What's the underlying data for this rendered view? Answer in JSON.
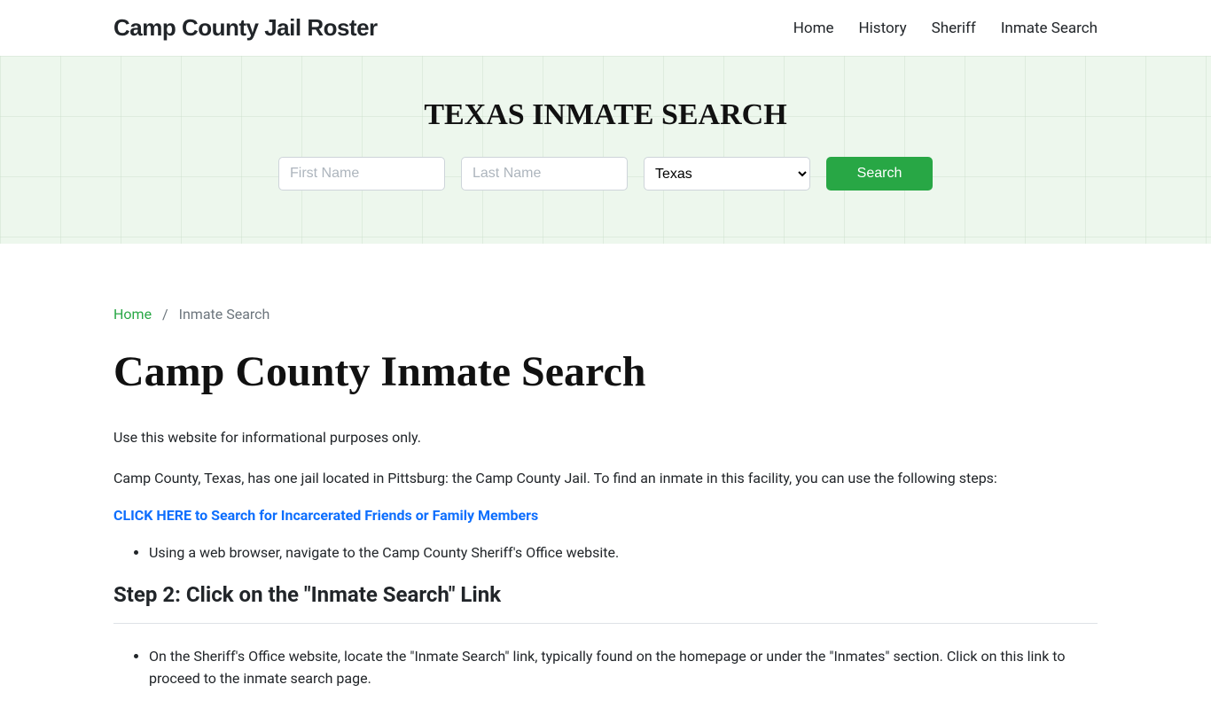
{
  "header": {
    "site_title": "Camp County Jail Roster",
    "nav": {
      "home": "Home",
      "history": "History",
      "sheriff": "Sheriff",
      "inmate_search": "Inmate Search"
    }
  },
  "hero": {
    "title": "TEXAS INMATE SEARCH",
    "first_name_placeholder": "First Name",
    "last_name_placeholder": "Last Name",
    "state_selected": "Texas",
    "search_button": "Search"
  },
  "breadcrumb": {
    "home": "Home",
    "sep": "/",
    "current": "Inmate Search"
  },
  "main": {
    "title": "Camp County Inmate Search",
    "intro1": "Use this website for informational purposes only.",
    "intro2": "Camp County, Texas, has one jail located in Pittsburg: the Camp County Jail. To find an inmate in this facility, you can use the following steps:",
    "cta": "CLICK HERE to Search for Incarcerated Friends or Family Members",
    "step1_bullet": "Using a web browser, navigate to the Camp County Sheriff's Office website.",
    "step2_heading": "Step 2: Click on the \"Inmate Search\" Link",
    "step2_bullet": "On the Sheriff's Office website, locate the \"Inmate Search\" link, typically found on the homepage or under the \"Inmates\" section. Click on this link to proceed to the inmate search page."
  }
}
